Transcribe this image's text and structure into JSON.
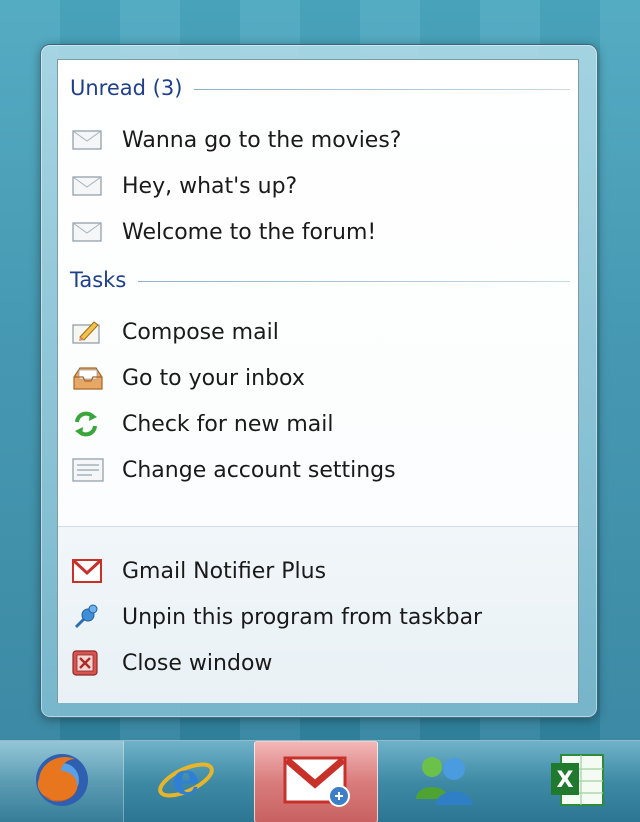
{
  "jumplist": {
    "sections": [
      {
        "title": "Unread (3)",
        "items": [
          {
            "label": "Wanna go to the movies?",
            "icon": "envelope-icon"
          },
          {
            "label": "Hey, what's up?",
            "icon": "envelope-icon"
          },
          {
            "label": "Welcome to the forum!",
            "icon": "envelope-icon"
          }
        ]
      },
      {
        "title": "Tasks",
        "items": [
          {
            "label": "Compose mail",
            "icon": "compose-icon"
          },
          {
            "label": "Go to your inbox",
            "icon": "inbox-icon"
          },
          {
            "label": "Check for new mail",
            "icon": "refresh-icon"
          },
          {
            "label": "Change account settings",
            "icon": "settings-list-icon"
          }
        ]
      }
    ],
    "footer": [
      {
        "label": "Gmail Notifier Plus",
        "icon": "gmail-icon"
      },
      {
        "label": "Unpin this program from taskbar",
        "icon": "unpin-icon"
      },
      {
        "label": "Close window",
        "icon": "close-window-icon"
      }
    ]
  },
  "taskbar": {
    "buttons": [
      {
        "name": "firefox",
        "icon": "firefox-icon"
      },
      {
        "name": "internet-explorer",
        "icon": "ie-icon"
      },
      {
        "name": "gmail-notifier",
        "icon": "gmail-icon",
        "active": true
      },
      {
        "name": "messenger",
        "icon": "messenger-icon"
      },
      {
        "name": "excel",
        "icon": "excel-icon"
      }
    ]
  },
  "colors": {
    "section_title": "#1e3f8a",
    "active_button": "#d97c7c",
    "gmail_red": "#c8302a"
  }
}
